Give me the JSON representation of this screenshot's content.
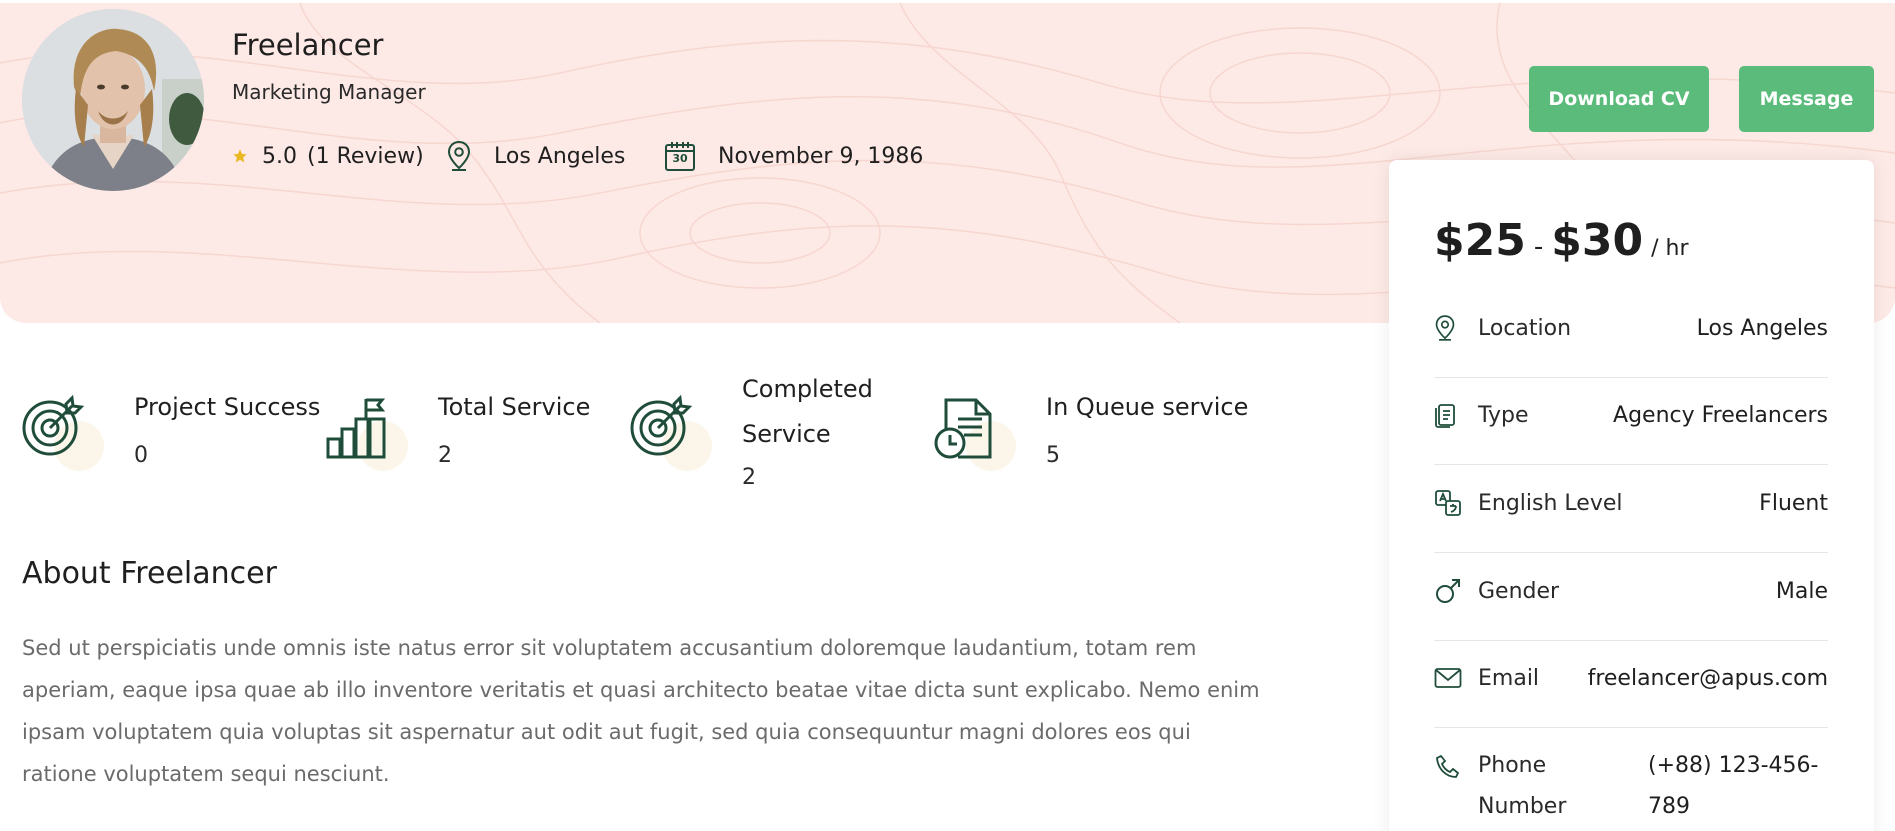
{
  "profile": {
    "name": "Freelancer",
    "role": "Marketing Manager",
    "rating": "5.0",
    "reviews": "(1 Review)",
    "location": "Los Angeles",
    "calendar_day": "30",
    "dob": "November 9, 1986"
  },
  "actions": {
    "download_cv": "Download CV",
    "message": "Message"
  },
  "rate": {
    "min": "$25",
    "separator": "-",
    "max": "$30",
    "unit": "/ hr"
  },
  "details": [
    {
      "label": "Location",
      "value": "Los Angeles",
      "icon": "location-pin-icon"
    },
    {
      "label": "Type",
      "value": "Agency Freelancers",
      "icon": "document-icon"
    },
    {
      "label": "English Level",
      "value": "Fluent",
      "icon": "translate-icon"
    },
    {
      "label": "Gender",
      "value": "Male",
      "icon": "male-symbol-icon"
    },
    {
      "label": "Email",
      "value": "freelancer@apus.com",
      "icon": "envelope-icon"
    },
    {
      "label": "Phone Number",
      "value": "(+88) 123-456-789",
      "icon": "phone-icon"
    }
  ],
  "stats": [
    {
      "title": "Project Success",
      "value": "0",
      "icon": "target-icon"
    },
    {
      "title": "Total Service",
      "value": "2",
      "icon": "growth-chart-icon"
    },
    {
      "title": "Completed Service",
      "value": "2",
      "icon": "target-icon"
    },
    {
      "title": "In Queue service",
      "value": "5",
      "icon": "queue-document-icon"
    }
  ],
  "about": {
    "title": "About Freelancer",
    "text": "Sed ut perspiciatis unde omnis iste natus error sit voluptatem accusantium doloremque laudantium, totam rem aperiam, eaque ipsa quae ab illo inventore veritatis et quasi architecto beatae vitae dicta sunt explicabo. Nemo enim ipsam voluptatem quia voluptas sit aspernatur aut odit aut fugit, sed quia consequuntur magni dolores eos qui ratione voluptatem sequi nesciunt."
  },
  "colors": {
    "hero_bg": "#fde9e5",
    "accent": "#5bbb7b",
    "icon": "#1f4d3a",
    "star": "#e8b923"
  }
}
